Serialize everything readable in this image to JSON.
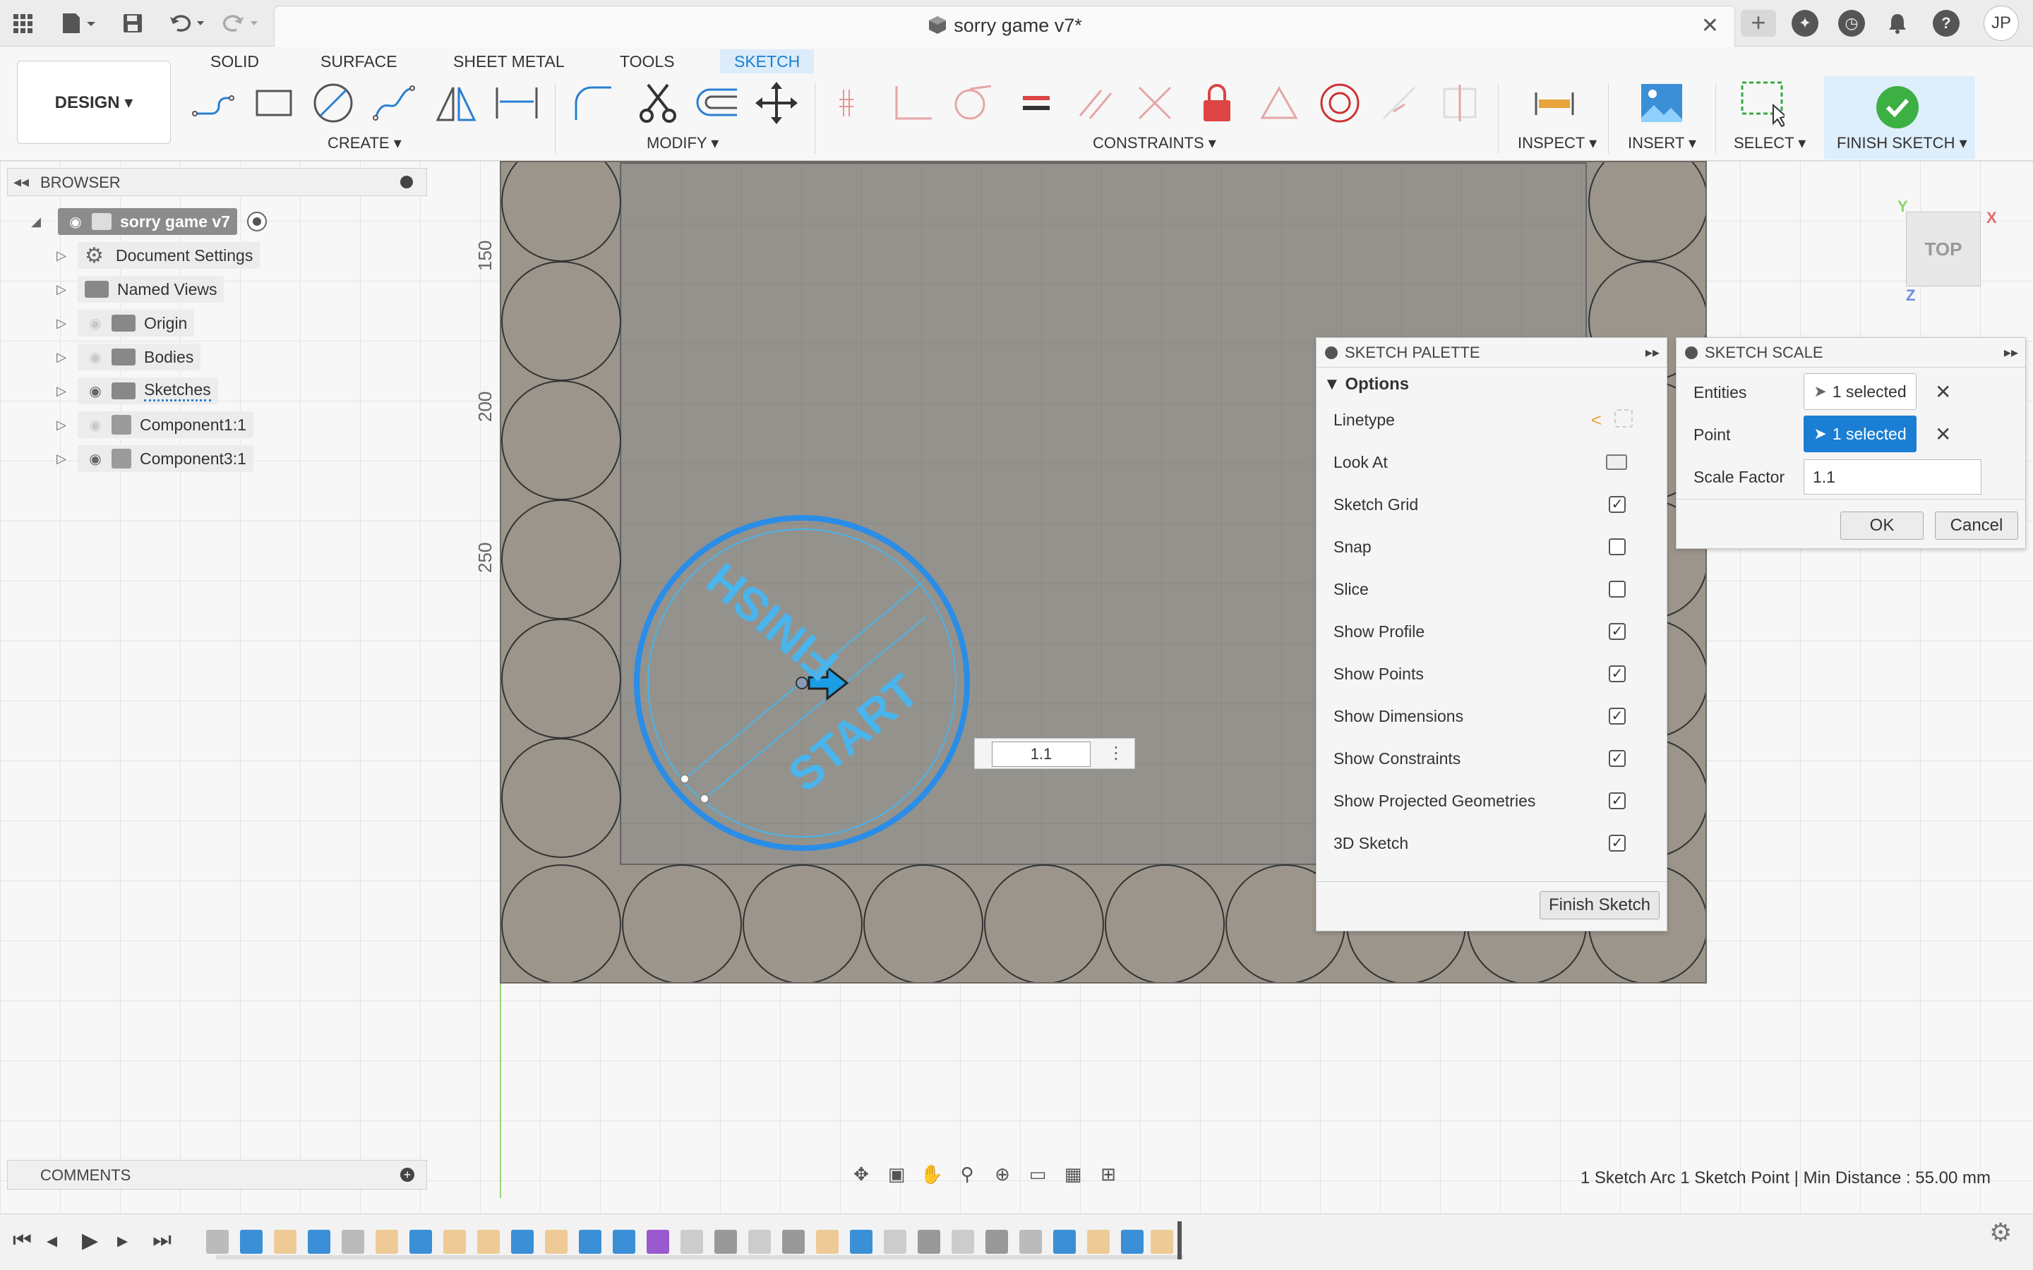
{
  "window": {
    "document_title": "sorry game v7*"
  },
  "user": {
    "initials": "JP"
  },
  "workspace": {
    "label": "DESIGN ▾"
  },
  "tabs": [
    {
      "label": "SOLID"
    },
    {
      "label": "SURFACE"
    },
    {
      "label": "SHEET METAL"
    },
    {
      "label": "TOOLS"
    },
    {
      "label": "SKETCH"
    }
  ],
  "toolbar_groups": {
    "create": "CREATE ▾",
    "modify": "MODIFY ▾",
    "constraints": "CONSTRAINTS ▾",
    "inspect": "INSPECT ▾",
    "insert": "INSERT ▾",
    "select": "SELECT ▾",
    "finish_sketch": "FINISH SKETCH ▾"
  },
  "browser": {
    "title": "BROWSER",
    "root": "sorry game v7",
    "items": [
      {
        "label": "Document Settings"
      },
      {
        "label": "Named Views"
      },
      {
        "label": "Origin"
      },
      {
        "label": "Bodies"
      },
      {
        "label": "Sketches"
      },
      {
        "label": "Component1:1"
      },
      {
        "label": "Component3:1"
      }
    ]
  },
  "ruler": {
    "marks": [
      "150",
      "200",
      "250"
    ]
  },
  "sketch": {
    "label_finish": "FINISH",
    "label_start": "START",
    "dimension_value": "1.1"
  },
  "sketch_palette": {
    "title": "SKETCH PALETTE",
    "section": "Options",
    "rows": [
      {
        "label": "Linetype",
        "kind": "icons"
      },
      {
        "label": "Look At",
        "kind": "icon"
      },
      {
        "label": "Sketch Grid",
        "checked": true
      },
      {
        "label": "Snap",
        "checked": false
      },
      {
        "label": "Slice",
        "checked": false
      },
      {
        "label": "Show Profile",
        "checked": true
      },
      {
        "label": "Show Points",
        "checked": true
      },
      {
        "label": "Show Dimensions",
        "checked": true
      },
      {
        "label": "Show Constraints",
        "checked": true
      },
      {
        "label": "Show Projected Geometries",
        "checked": true
      },
      {
        "label": "3D Sketch",
        "checked": true
      }
    ],
    "finish_button": "Finish Sketch"
  },
  "sketch_scale": {
    "title": "SKETCH SCALE",
    "entities_label": "Entities",
    "entities_value": "1 selected",
    "point_label": "Point",
    "point_value": "1 selected",
    "scale_factor_label": "Scale Factor",
    "scale_factor_value": "1.1",
    "ok": "OK",
    "cancel": "Cancel"
  },
  "viewcube": {
    "face": "TOP",
    "x": "X",
    "y": "Y",
    "z": "Z"
  },
  "comments": {
    "title": "COMMENTS"
  },
  "status": {
    "text": "1 Sketch Arc 1 Sketch Point | Min Distance : 55.00 mm"
  },
  "colors": {
    "accent": "#1a7fd4",
    "board": "#9c958b",
    "sketch_blue": "#2a8de8",
    "sketch_text": "#4ab4ec"
  }
}
